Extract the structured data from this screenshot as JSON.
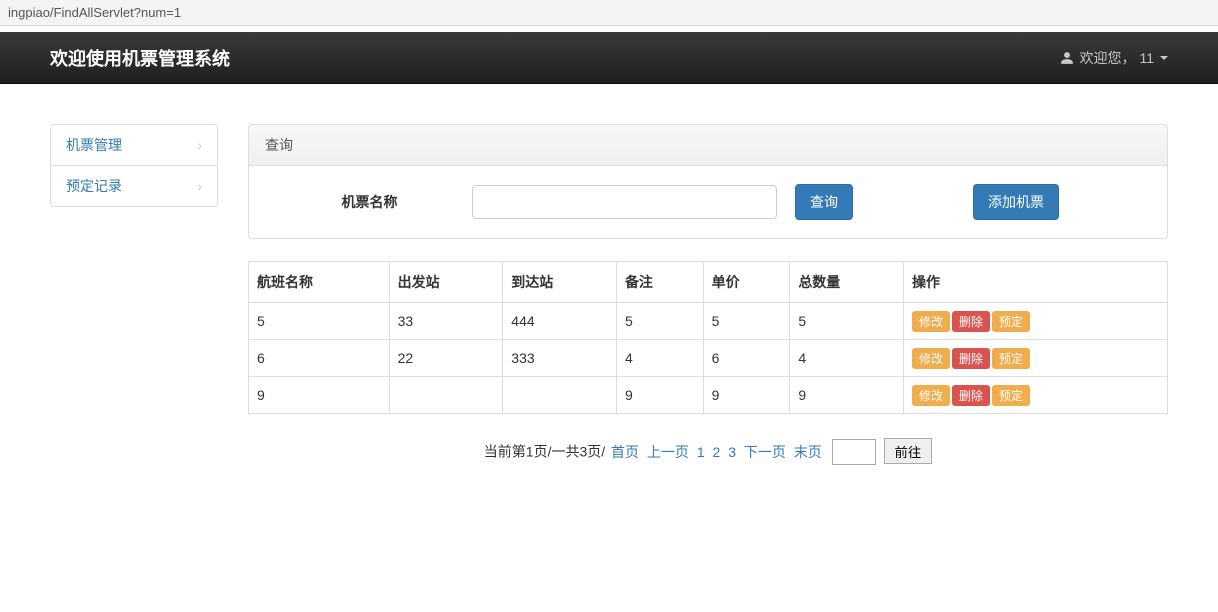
{
  "url_fragment": "ingpiao/FindAllServlet?num=1",
  "brand": "欢迎使用机票管理系统",
  "user": {
    "greeting": "欢迎您，",
    "name": "11"
  },
  "sidebar": {
    "items": [
      {
        "label": "机票管理"
      },
      {
        "label": "预定记录"
      }
    ]
  },
  "panel": {
    "title": "查询",
    "search_label": "机票名称",
    "search_btn": "查询",
    "add_btn": "添加机票"
  },
  "table": {
    "headers": [
      "航班名称",
      "出发站",
      "到达站",
      "备注",
      "单价",
      "总数量",
      "操作"
    ],
    "rows": [
      {
        "cells": [
          "5",
          "33",
          "444",
          "5",
          "5",
          "5"
        ]
      },
      {
        "cells": [
          "6",
          "22",
          "333",
          "4",
          "6",
          "4"
        ]
      },
      {
        "cells": [
          "9",
          "",
          "",
          "9",
          "9",
          "9"
        ]
      }
    ],
    "ops": {
      "edit": "修改",
      "delete": "删除",
      "book": "预定"
    }
  },
  "pagination": {
    "current_text": "当前第1页/一共3页/",
    "first": "首页",
    "prev": "上一页",
    "p1": "1",
    "p2": "2",
    "p3": "3",
    "next": "下一页",
    "last": "末页",
    "go": "前往"
  }
}
